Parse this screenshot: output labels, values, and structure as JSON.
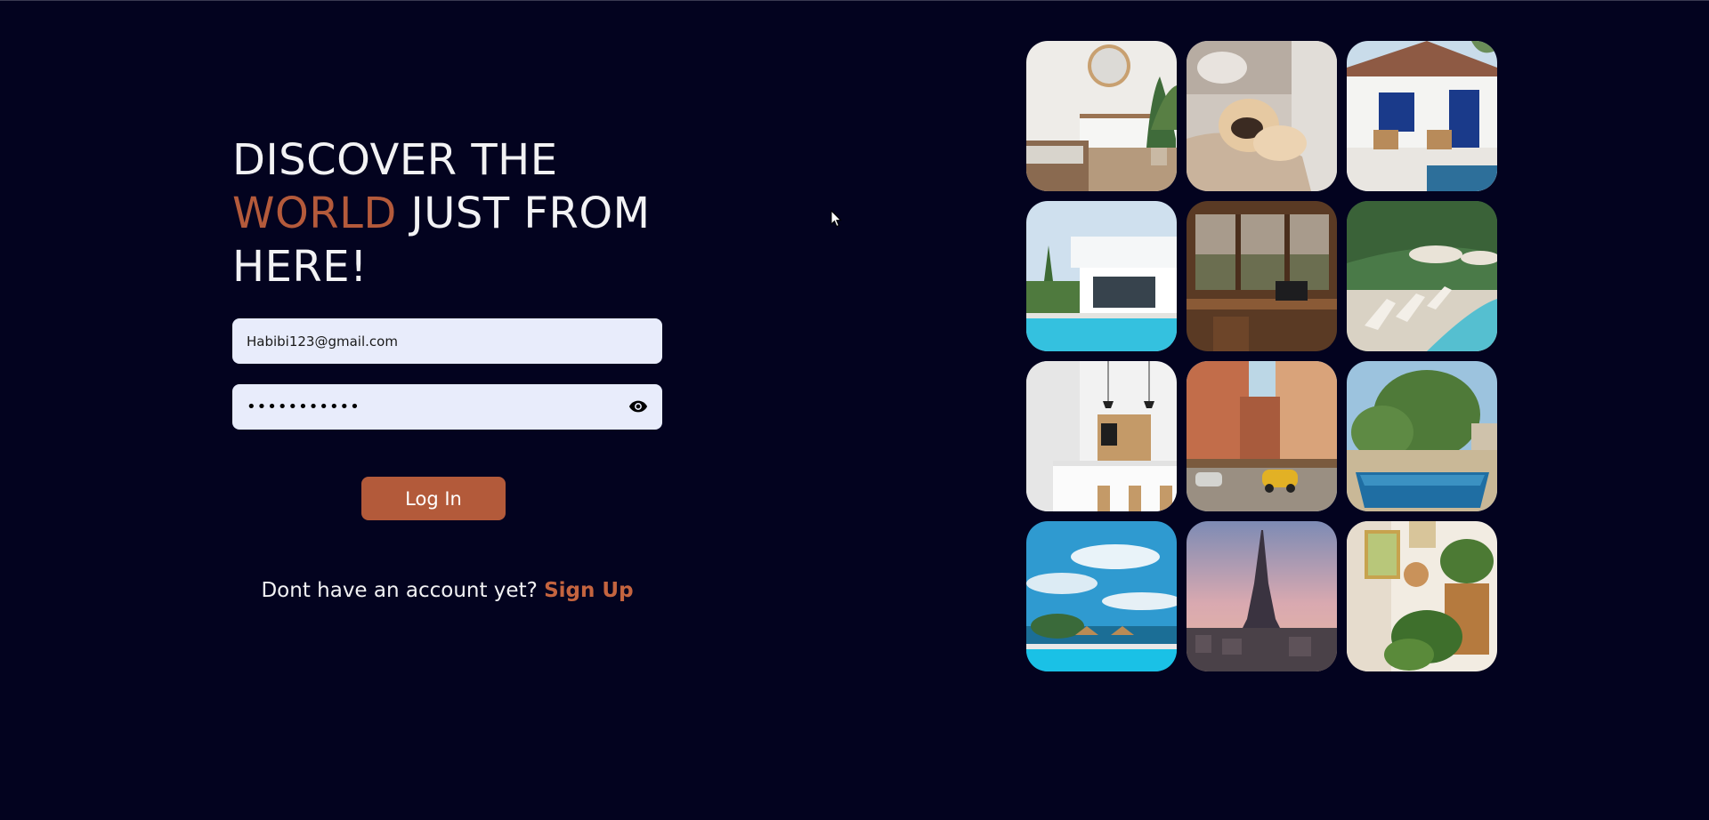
{
  "headline": {
    "line1": "DISCOVER THE",
    "accent_word": "WORLD",
    "line2_rest": " JUST FROM",
    "line3": "HERE!"
  },
  "email": {
    "value": "Habibi123@gmail.com"
  },
  "password": {
    "masked_value": "•••••••••••",
    "toggle_icon": "eye-icon"
  },
  "login_button": {
    "label": "Log In"
  },
  "signup": {
    "prompt": "Dont have an account yet? ",
    "link_label": "Sign Up"
  },
  "colors": {
    "background": "#03031f",
    "accent": "#b45a3b",
    "field_bg": "#e8ecfb",
    "button_bg": "#b35a3a"
  },
  "gallery": {
    "tiles": [
      "bedroom-photo",
      "pug-on-sofa-photo",
      "patio-blue-doors-photo",
      "modern-villa-pool-photo",
      "wooden-desk-window-photo",
      "poolside-loungers-photo",
      "white-kitchen-photo",
      "street-yellow-car-photo",
      "garden-pool-photo",
      "sea-pool-sky-photo",
      "eiffel-tower-sunset-photo",
      "plants-shelf-photo"
    ]
  }
}
